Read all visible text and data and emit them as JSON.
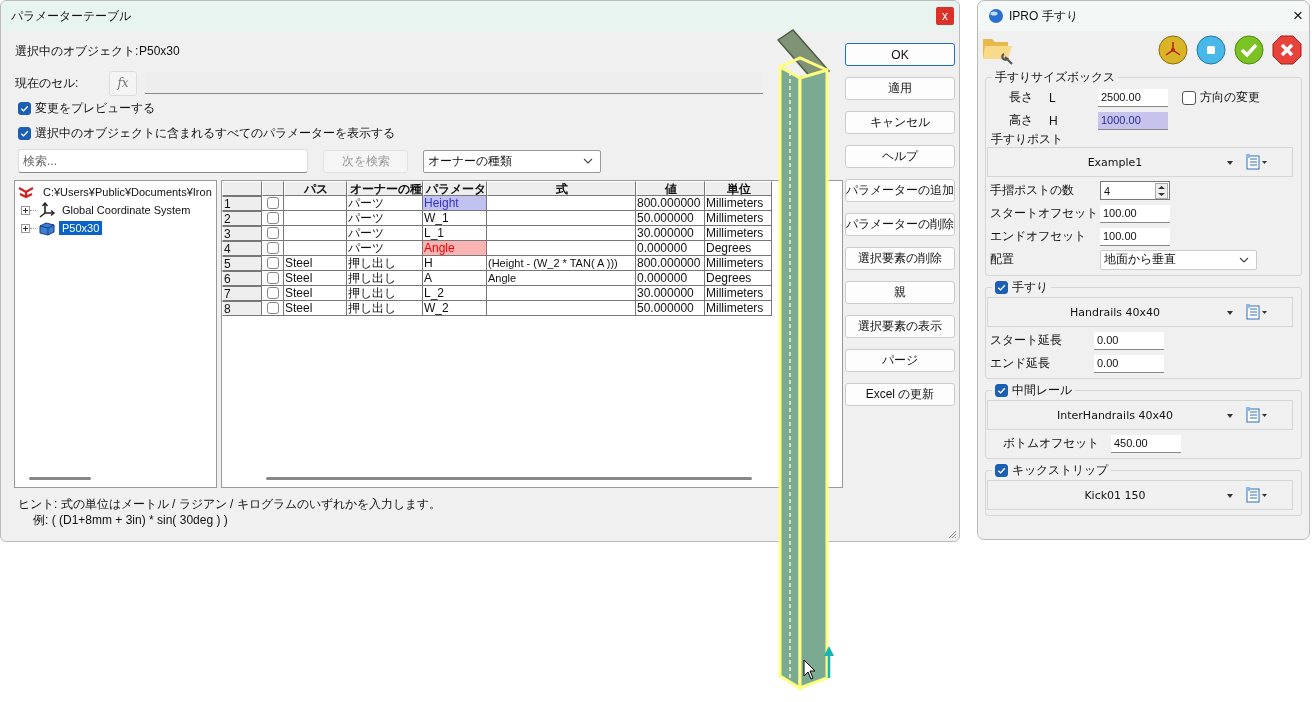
{
  "params": {
    "title": "パラメーターテーブル",
    "close": "x",
    "selected_object_label": "選択中のオブジェクト:",
    "selected_object": "P50x30",
    "current_cell_label": "現在のセル:",
    "fx": "fx",
    "options": [
      {
        "label": "変更をプレビューする",
        "checked": true
      },
      {
        "label": "選択中のオブジェクトに含まれるすべてのパラメーターを表示する",
        "checked": true
      }
    ],
    "search": {
      "placeholder": "検索..."
    },
    "find_next": {
      "label": "次を検索",
      "disabled": true
    },
    "owner_filter": "オーナーの種類",
    "tree": [
      {
        "label": "C:¥Users¥Public¥Documents¥Iron",
        "kind": "file",
        "selected": false,
        "children": [
          {
            "label": "Global Coordinate System",
            "kind": "axes",
            "selected": false,
            "expanded": false
          },
          {
            "label": "P50x30",
            "kind": "part",
            "selected": true,
            "expanded": false
          }
        ]
      }
    ],
    "table": {
      "columns": [
        "パス",
        "オーナーの種",
        "パラメータ",
        "式",
        "値",
        "単位"
      ],
      "rows": [
        {
          "number": "1",
          "checked": false,
          "owner": "パーツ",
          "param": "Height",
          "color": "#3333cc",
          "value": "800.000000",
          "unit": "Millimeters"
        },
        {
          "number": "2",
          "checked": false,
          "owner": "パーツ",
          "param": "W_1",
          "value": "50.000000",
          "unit": "Millimeters"
        },
        {
          "number": "3",
          "checked": false,
          "owner": "パーツ",
          "param": "L_1",
          "value": "30.000000",
          "unit": "Millimeters"
        },
        {
          "number": "4",
          "checked": false,
          "owner": "パーツ",
          "param": "Angle",
          "color": "#ee0000",
          "value": "0.000000",
          "unit": "Degrees"
        },
        {
          "number": "5",
          "checked": false,
          "path": "Steel",
          "owner": "押し出し",
          "param": "H",
          "formula": "(Height - (W_2 * TAN( A )))",
          "value": "800.000000",
          "unit": "Millimeters"
        },
        {
          "number": "6",
          "checked": false,
          "path": "Steel",
          "owner": "押し出し",
          "param": "A",
          "formula": "Angle",
          "value": "0.000000",
          "unit": "Degrees"
        },
        {
          "number": "7",
          "checked": false,
          "path": "Steel",
          "owner": "押し出し",
          "param": "L_2",
          "value": "30.000000",
          "unit": "Millimeters"
        },
        {
          "number": "8",
          "checked": false,
          "path": "Steel",
          "owner": "押し出し",
          "param": "W_2",
          "value": "50.000000",
          "unit": "Millimeters"
        }
      ]
    },
    "hint": "ヒント: 式の単位はメートル / ラジアン / キログラムのいずれかを入力します。",
    "example": "例: ( (D1+8mm + 3in) * sin( 30deg ) )",
    "buttons": [
      {
        "label": "OK",
        "default": true
      },
      {
        "label": "適用",
        "default": false
      },
      {
        "label": "キャンセル",
        "default": false
      },
      {
        "label": "ヘルプ",
        "default": false
      },
      {
        "label": "パラメーターの追加",
        "default": false
      },
      {
        "label": "パラメーターの削除",
        "default": false
      },
      {
        "label": "選択要素の削除",
        "default": false
      },
      {
        "label": "親",
        "default": false
      },
      {
        "label": "選択要素の表示",
        "default": false
      },
      {
        "label": "パージ",
        "default": false
      },
      {
        "label": "Excel の更新",
        "default": false
      }
    ]
  },
  "railing": {
    "title": "IPRO 手すり",
    "close": "×",
    "size_box": {
      "title": "手すりサイズボックス",
      "fields": [
        {
          "label": "長さ",
          "symbol": "L",
          "value": "2500.00",
          "highlighted": false
        },
        {
          "label": "高さ",
          "symbol": "H",
          "value": "1000.00",
          "highlighted": true
        }
      ],
      "reverse": {
        "label": "方向の変更",
        "checked": false
      },
      "post_title": "手すりポスト",
      "post_profile": "Example1",
      "post_fields": [
        {
          "label": "手摺ポストの数",
          "value": "4",
          "kind": "spinner"
        },
        {
          "label": "スタートオフセット",
          "value": "100.00",
          "kind": "text"
        },
        {
          "label": "エンドオフセット",
          "value": "100.00",
          "kind": "text"
        },
        {
          "label": "配置",
          "value": "地面から垂直",
          "kind": "select"
        }
      ]
    },
    "sections": [
      {
        "title": "手すり",
        "checked": true,
        "profile": "Handrails 40x40",
        "fields": [
          {
            "label": "スタート延長",
            "value": "0.00"
          },
          {
            "label": "エンド延長",
            "value": "0.00"
          }
        ]
      },
      {
        "title": "中間レール",
        "checked": true,
        "profile": "InterHandrails 40x40",
        "fields": [
          {
            "label": "ボトムオフセット",
            "value": "450.00"
          }
        ]
      },
      {
        "title": "キックストリップ",
        "checked": true,
        "profile": "Kick01 150"
      }
    ]
  }
}
